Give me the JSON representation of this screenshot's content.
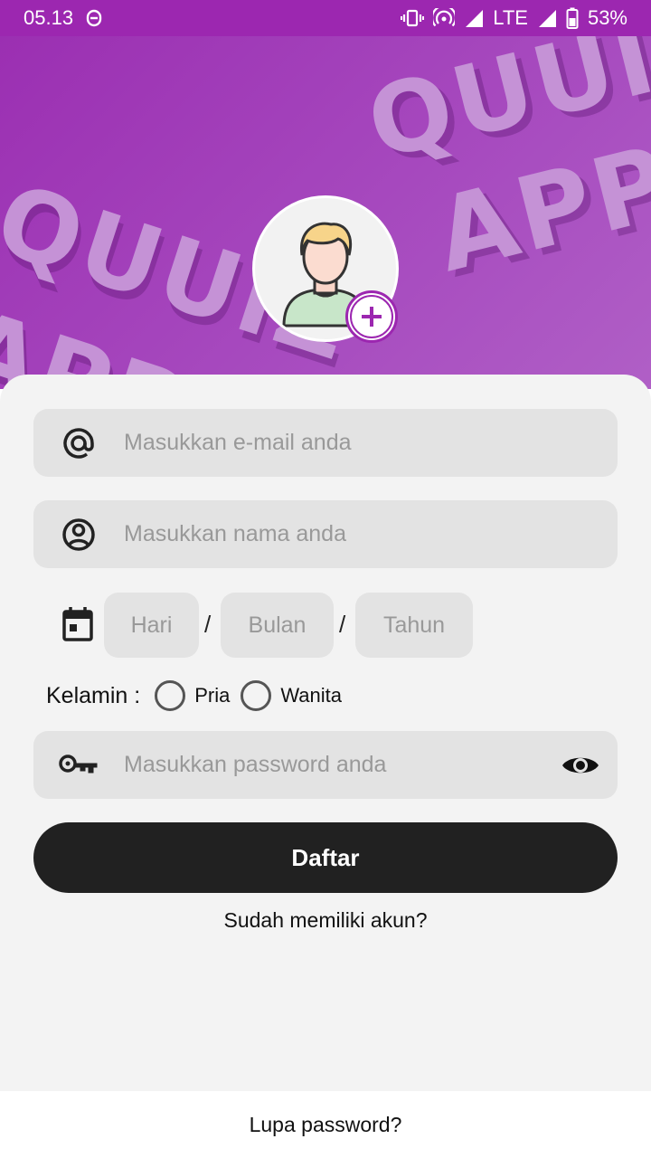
{
  "status_bar": {
    "time": "05.13",
    "network": "LTE",
    "battery": "53%"
  },
  "header": {
    "words": [
      "QUUIZ",
      "APP",
      "QUUIZ",
      "APP"
    ]
  },
  "form": {
    "email_placeholder": "Masukkan e-mail anda",
    "name_placeholder": "Masukkan nama anda",
    "day_placeholder": "Hari",
    "month_placeholder": "Bulan",
    "year_placeholder": "Tahun",
    "date_separator": "/",
    "gender_label": "Kelamin :",
    "gender_options": [
      "Pria",
      "Wanita"
    ],
    "password_placeholder": "Masukkan password anda",
    "submit_label": "Daftar",
    "login_link": "Sudah memiliki akun?",
    "forgot_link": "Lupa password?"
  },
  "colors": {
    "accent": "#9c27b0",
    "button": "#212121",
    "field_bg": "#e3e3e3",
    "card_bg": "#f3f3f3"
  },
  "icons": {
    "email": "at-sign-icon",
    "name": "user-circle-icon",
    "date": "calendar-icon",
    "password": "key-icon",
    "visibility": "eye-icon",
    "add_photo": "plus-icon"
  }
}
